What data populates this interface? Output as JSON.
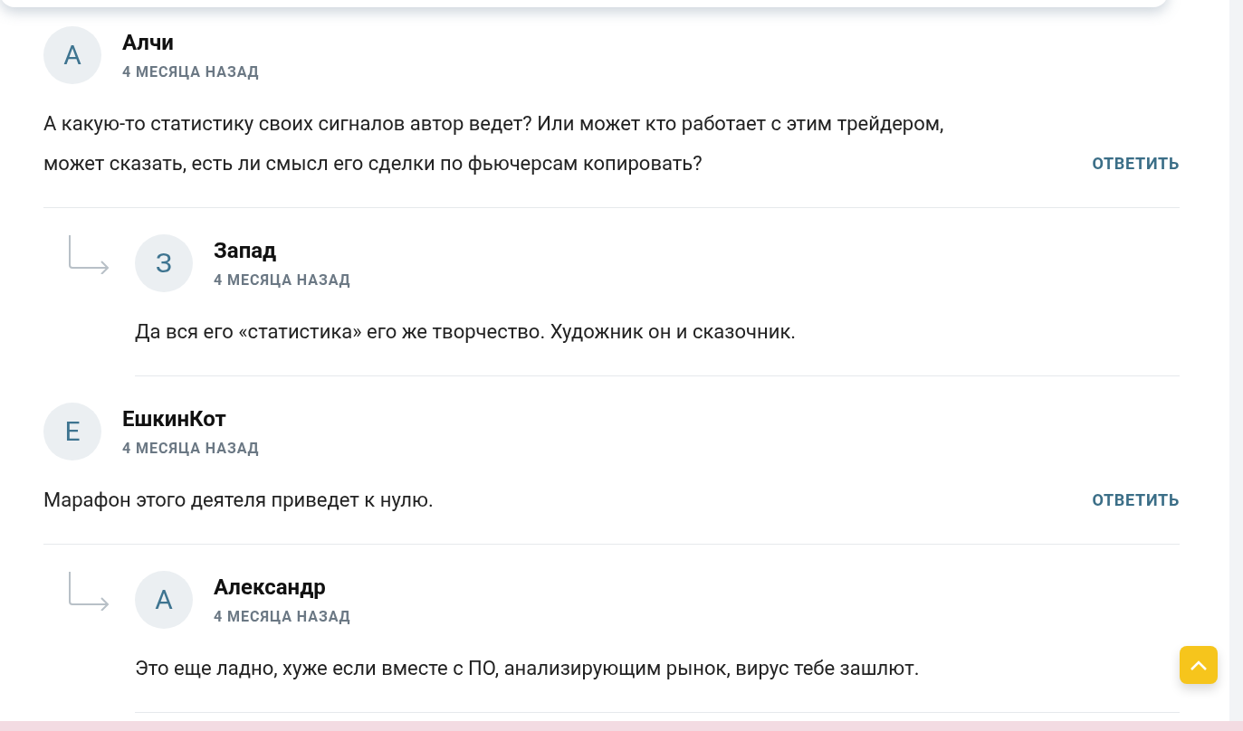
{
  "comments": [
    {
      "avatar_letter": "А",
      "author": "Алчи",
      "time": "4 МЕСЯЦА НАЗАД",
      "text": "А какую-то статистику своих сигналов автор ведет? Или может кто работает с этим трейдером, может сказать, есть ли смысл его сделки по фьючерсам копировать?",
      "reply_label": "ОТВЕТИТЬ",
      "children": [
        {
          "avatar_letter": "З",
          "author": "Запад",
          "time": "4 МЕСЯЦА НАЗАД",
          "text": "Да вся его «статистика» его же творчество. Художник он и сказочник."
        }
      ]
    },
    {
      "avatar_letter": "Е",
      "author": "ЕшкинКот",
      "time": "4 МЕСЯЦА НАЗАД",
      "text": "Марафон этого деятеля приведет к нулю.",
      "reply_label": "ОТВЕТИТЬ",
      "children": [
        {
          "avatar_letter": "А",
          "author": "Александр",
          "time": "4 МЕСЯЦА НАЗАД",
          "text": "Это еще ладно, хуже если вместе с ПО, анализирующим рынок, вирус тебе зашлют."
        }
      ]
    }
  ],
  "scroll_top_button": {
    "kind": "up"
  }
}
